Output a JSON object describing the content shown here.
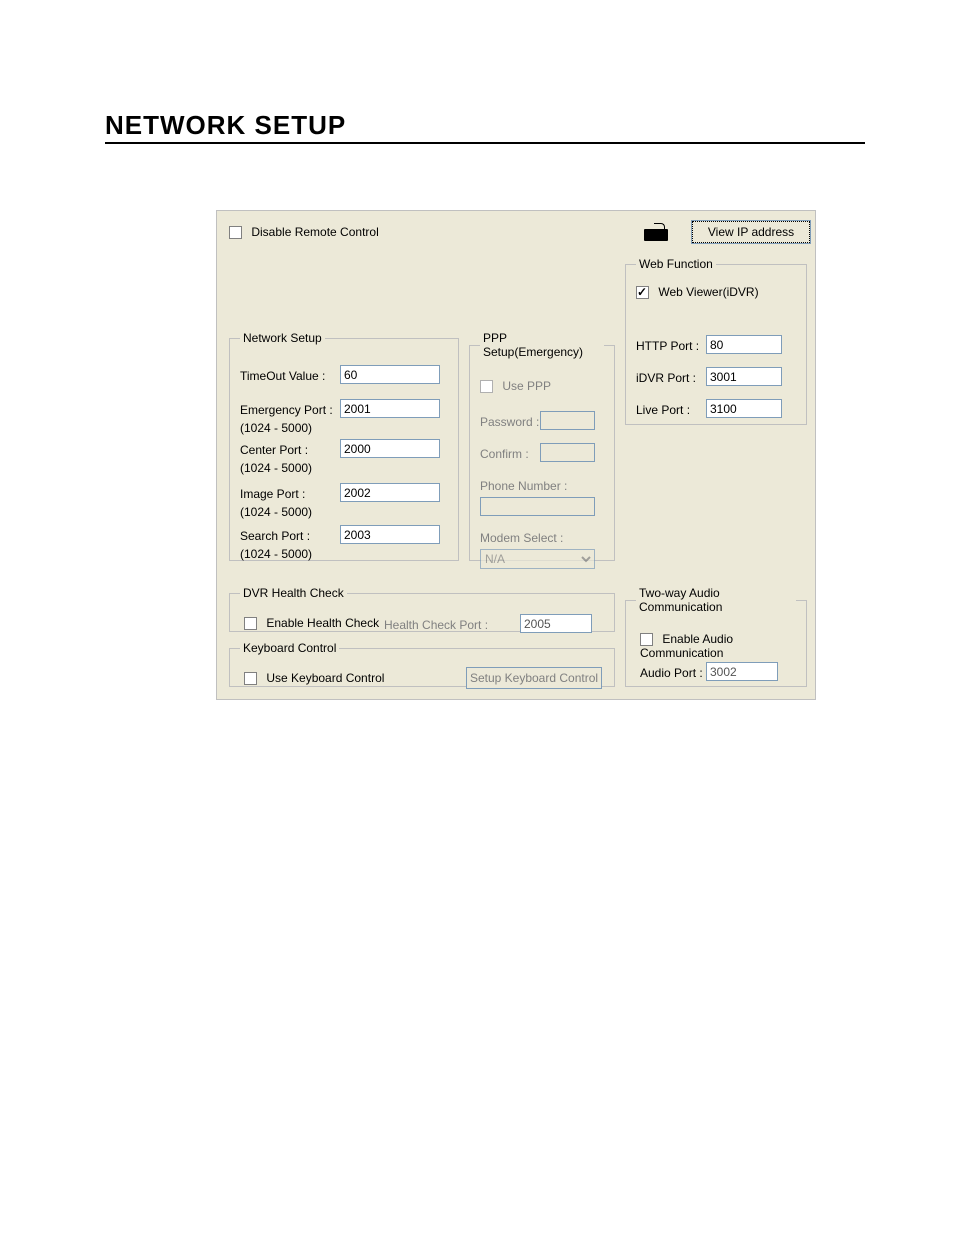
{
  "page": {
    "heading": "NETWORK SETUP"
  },
  "topbar": {
    "disable_remote_label": "Disable Remote Control",
    "view_ip_button": "View  IP address"
  },
  "web_function": {
    "legend": "Web Function",
    "web_viewer_label": "Web Viewer(iDVR)",
    "web_viewer_checked": true,
    "http_port_label": "HTTP Port :",
    "http_port_value": "80",
    "idvr_port_label": "iDVR Port :",
    "idvr_port_value": "3001",
    "live_port_label": "Live Port :",
    "live_port_value": "3100"
  },
  "network_setup": {
    "legend": "Network Setup",
    "timeout_label": "TimeOut Value :",
    "timeout_value": "60",
    "emergency_port_label": "Emergency Port :",
    "emergency_port_value": "2001",
    "center_port_label": "Center Port :",
    "center_port_value": "2000",
    "image_port_label": "Image Port :",
    "image_port_value": "2002",
    "search_port_label": "Search Port :",
    "search_port_value": "2003",
    "range_hint": "(1024 - 5000)"
  },
  "ppp": {
    "legend": "PPP Setup(Emergency)",
    "use_ppp_label": "Use PPP",
    "password_label": "Password :",
    "confirm_label": "Confirm :",
    "phone_label": "Phone Number :",
    "modem_label": "Modem Select :",
    "modem_value": "N/A"
  },
  "health": {
    "legend": "DVR Health Check",
    "enable_label": "Enable Health Check",
    "port_label": "Health Check Port  :",
    "port_value": "2005"
  },
  "keyboard": {
    "legend": "Keyboard Control",
    "use_label": "Use Keyboard Control",
    "setup_button": "Setup Keyboard Control"
  },
  "audio": {
    "legend": "Two-way Audio Communication",
    "enable_label": "Enable Audio Communication",
    "port_label": "Audio Port :",
    "port_value": "3002"
  }
}
